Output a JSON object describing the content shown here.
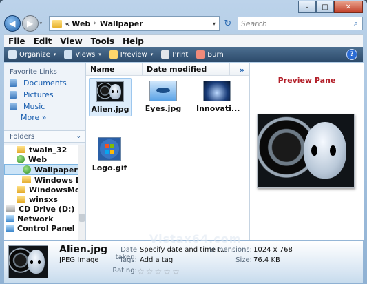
{
  "window": {
    "minimize_glyph": "–",
    "maximize_glyph": "□",
    "close_glyph": "✕"
  },
  "nav": {
    "back_glyph": "◀",
    "forward_glyph": "▶",
    "dropdown_glyph": "▾",
    "breadcrumb_prefix": "«",
    "breadcrumb": [
      "Web",
      "Wallpaper"
    ],
    "separator": "›",
    "refresh_glyph": "↻",
    "search_placeholder": "Search",
    "search_glyph": "⌕"
  },
  "menubar": [
    {
      "first": "F",
      "rest": "ile"
    },
    {
      "first": "E",
      "rest": "dit"
    },
    {
      "first": "V",
      "rest": "iew"
    },
    {
      "first": "T",
      "rest": "ools"
    },
    {
      "first": "H",
      "rest": "elp"
    }
  ],
  "commands": [
    {
      "label": "Organize",
      "icon": "organize-icon",
      "color": "#d9e6f3",
      "has_dropdown": true
    },
    {
      "label": "Views",
      "icon": "views-icon",
      "color": "#cfe0f0",
      "has_dropdown": true
    },
    {
      "label": "Preview",
      "icon": "preview-icon",
      "color": "#ffd66b",
      "has_dropdown": true
    },
    {
      "label": "Print",
      "icon": "print-icon",
      "color": "#e2e6ea",
      "has_dropdown": false
    },
    {
      "label": "Burn",
      "icon": "burn-icon",
      "color": "#f08a7a",
      "has_dropdown": false
    }
  ],
  "help_glyph": "?",
  "sidebar": {
    "favorites_title": "Favorite Links",
    "favorites": [
      "Documents",
      "Pictures",
      "Music"
    ],
    "more_label": "More",
    "more_glyph": "»",
    "folders_title": "Folders",
    "folders_chevron": "⌄",
    "tree": [
      {
        "label": "twain_32",
        "icon": "folder",
        "indent": 18
      },
      {
        "label": "Web",
        "icon": "green",
        "indent": 18
      },
      {
        "label": "Wallpaper",
        "icon": "green",
        "indent": 26,
        "selected": true
      },
      {
        "label": "Windows D",
        "icon": "folder",
        "indent": 26
      },
      {
        "label": "WindowsMob",
        "icon": "folder",
        "indent": 18
      },
      {
        "label": "winsxs",
        "icon": "folder",
        "indent": 18
      },
      {
        "label": "CD Drive (D:)",
        "icon": "drive",
        "indent": 2
      },
      {
        "label": "Network",
        "icon": "network",
        "indent": 2
      },
      {
        "label": "Control Panel",
        "icon": "panel",
        "indent": 2
      }
    ]
  },
  "columns": {
    "name": "Name",
    "date": "Date modified",
    "more": "»"
  },
  "files": [
    {
      "name": "Alien.jpg",
      "kind": "alien",
      "selected": true
    },
    {
      "name": "Eyes.jpg",
      "kind": "eyes",
      "selected": false
    },
    {
      "name": "Innovati...",
      "kind": "innov",
      "selected": false
    },
    {
      "name": "Logo.gif",
      "kind": "logo",
      "selected": false
    }
  ],
  "preview": {
    "title": "Preview Pane"
  },
  "details": {
    "file_name": "Alien.jpg",
    "file_type": "JPEG Image",
    "date_taken_label": "Date taken:",
    "date_taken_value": "Specify date and time t...",
    "tags_label": "Tags:",
    "tags_value": "Add a tag",
    "rating_label": "Rating:",
    "rating_stars": 5,
    "rating_filled": 0,
    "dimensions_label": "Dimensions:",
    "dimensions_value": "1024 x 768",
    "size_label": "Size:",
    "size_value": "76.4 KB"
  },
  "watermark": "Vistax64.com"
}
